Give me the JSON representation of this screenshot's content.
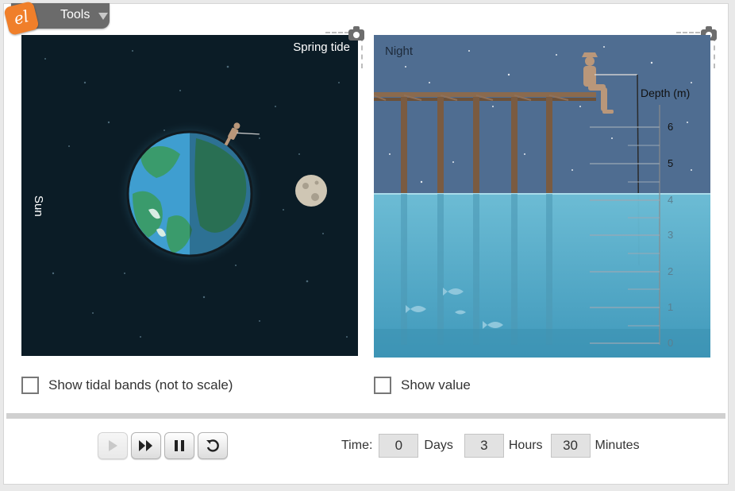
{
  "tools": {
    "label": "Tools",
    "logo_text": "el"
  },
  "space_view": {
    "tide_label": "Spring tide",
    "sun_label": "Sun"
  },
  "pier_view": {
    "time_of_day_label": "Night",
    "depth_title": "Depth (m)",
    "depth_ticks": [
      "6",
      "5",
      "4",
      "3",
      "2",
      "1",
      "0"
    ]
  },
  "checkboxes": {
    "tidal_bands": {
      "label": "Show tidal bands (not to scale)",
      "checked": false
    },
    "show_value": {
      "label": "Show value",
      "checked": false
    }
  },
  "time": {
    "label": "Time:",
    "days_value": "0",
    "days_unit": "Days",
    "hours_value": "3",
    "hours_unit": "Hours",
    "minutes_value": "30",
    "minutes_unit": "Minutes"
  },
  "icons": {
    "play": "play-icon",
    "fast_forward": "fast-forward-icon",
    "pause": "pause-icon",
    "reset": "reset-icon",
    "camera": "camera-icon"
  },
  "colors": {
    "accent_logo": "#f07f2a",
    "space_bg": "#0b1c26",
    "sky": "#4f6d91",
    "water": "#5ab1cc"
  }
}
